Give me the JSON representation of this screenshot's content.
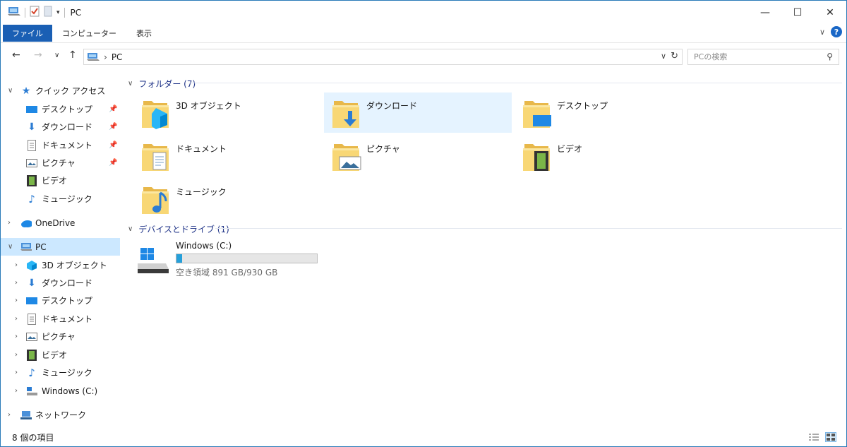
{
  "window": {
    "title": "PC"
  },
  "ribbon": {
    "tabs": [
      "ファイル",
      "コンピューター",
      "表示"
    ]
  },
  "address": {
    "path": "PC"
  },
  "search": {
    "placeholder": "PCの検索"
  },
  "nav": {
    "quick_access": "クイック アクセス",
    "quick_items": [
      "デスクトップ",
      "ダウンロード",
      "ドキュメント",
      "ピクチャ",
      "ビデオ",
      "ミュージック"
    ],
    "onedrive": "OneDrive",
    "pc": "PC",
    "pc_items": [
      "3D オブジェクト",
      "ダウンロード",
      "デスクトップ",
      "ドキュメント",
      "ピクチャ",
      "ビデオ",
      "ミュージック",
      "Windows (C:)"
    ],
    "network": "ネットワーク"
  },
  "content": {
    "folders_header": "フォルダー (7)",
    "folders": [
      "3D オブジェクト",
      "ダウンロード",
      "デスクトップ",
      "ドキュメント",
      "ピクチャ",
      "ビデオ",
      "ミュージック"
    ],
    "devices_header": "デバイスとドライブ (1)",
    "drive": {
      "name": "Windows (C:)",
      "free_text": "空き領域 891 GB/930 GB",
      "used_fraction": 0.042
    }
  },
  "status": {
    "count": "8 個の項目"
  },
  "colors": {
    "accent": "#1a5fb4",
    "selection": "#cce8ff",
    "hover": "#e5f3ff",
    "folder": "#f6d365",
    "drive_fill": "#26a0da"
  }
}
